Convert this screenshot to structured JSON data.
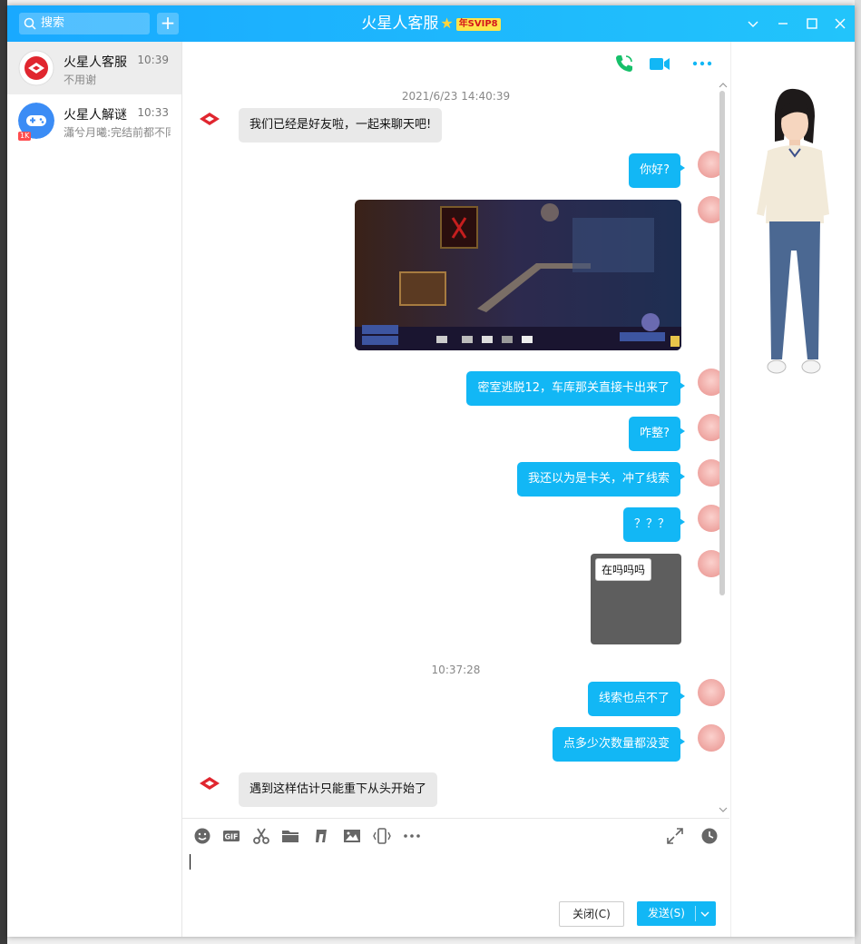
{
  "titlebar": {
    "search_placeholder": "搜索",
    "title": "火星人客服",
    "vip_badge": "年SVIP8"
  },
  "sidebar": {
    "contacts": [
      {
        "name": "火星人客服",
        "time": "10:39",
        "preview": "不用谢"
      },
      {
        "name": "火星人解谜",
        "time": "10:33",
        "preview": "瀟兮月曦:完结前都不同",
        "badge": "1K"
      }
    ]
  },
  "chat": {
    "timestamps": [
      "2021/6/23 14:40:39",
      "10:37:28"
    ],
    "messages": [
      {
        "dir": "in",
        "text": "我们已经是好友啦，一起来聊天吧!"
      },
      {
        "dir": "out",
        "text": "你好?"
      },
      {
        "dir": "out",
        "text": "密室逃脱12，车库那关直接卡出来了"
      },
      {
        "dir": "out",
        "text": "咋整?"
      },
      {
        "dir": "out",
        "text": "我还以为是卡关，冲了线索"
      },
      {
        "dir": "out",
        "text": "？？？"
      },
      {
        "dir": "out",
        "text": "在吗吗吗"
      },
      {
        "dir": "out",
        "text": "线索也点不了"
      },
      {
        "dir": "out",
        "text": "点多少次数量都没变"
      },
      {
        "dir": "in",
        "text": "遇到这样估计只能重下从头开始了"
      }
    ]
  },
  "footer": {
    "close_label": "关闭(C)",
    "send_label": "发送(S)"
  },
  "colors": {
    "accent": "#12b7f5",
    "titlebar": "#19a9ff"
  }
}
